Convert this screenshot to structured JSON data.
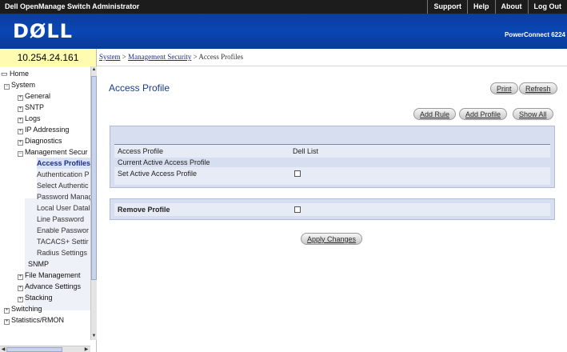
{
  "app": {
    "title": "Dell OpenManage Switch Administrator",
    "top_links": [
      "Support",
      "Help",
      "About",
      "Log Out"
    ],
    "logo": "DØLL",
    "product": "PowerConnect 6224"
  },
  "ip_address": "10.254.24.161",
  "breadcrumb": {
    "items": [
      "System",
      "Management Security"
    ],
    "separator": " > ",
    "current": "Access Profiles"
  },
  "tree": [
    {
      "label": "Home",
      "icon": "home-icon"
    },
    {
      "label": "System",
      "icon": "minus"
    },
    {
      "label": "General",
      "icon": "plus"
    },
    {
      "label": "SNTP",
      "icon": "plus"
    },
    {
      "label": "Logs",
      "icon": "plus"
    },
    {
      "label": "IP Addressing",
      "icon": "plus"
    },
    {
      "label": "Diagnostics",
      "icon": "plus"
    },
    {
      "label": "Management Secur",
      "icon": "minus"
    },
    {
      "label": "Access Profiles",
      "icon": "none"
    },
    {
      "label": "Authentication P",
      "icon": "none"
    },
    {
      "label": "Select Authentic",
      "icon": "none"
    },
    {
      "label": "Password Manaç",
      "icon": "none"
    },
    {
      "label": "Local User Datal",
      "icon": "none"
    },
    {
      "label": "Line Password",
      "icon": "none"
    },
    {
      "label": "Enable Passwor",
      "icon": "none"
    },
    {
      "label": "TACACS+ Settir",
      "icon": "none"
    },
    {
      "label": "Radius Settings",
      "icon": "none"
    },
    {
      "label": "SNMP",
      "icon": "none"
    },
    {
      "label": "File Management",
      "icon": "plus"
    },
    {
      "label": "Advance Settings",
      "icon": "plus"
    },
    {
      "label": "Stacking",
      "icon": "plus"
    },
    {
      "label": "Switching",
      "icon": "plus"
    },
    {
      "label": "Statistics/RMON",
      "icon": "plus"
    }
  ],
  "page": {
    "title": "Access Profile",
    "buttons": {
      "print": "Print",
      "refresh": "Refresh",
      "add_rule": "Add Rule",
      "add_profile": "Add Profile",
      "show_all": "Show All",
      "apply": "Apply Changes"
    },
    "form": {
      "access_profile_label": "Access Profile",
      "access_profile_value": "Dell List",
      "current_active_label": "Current Active Access Profile",
      "set_active_label": "Set Active Access Profile",
      "set_active_checked": false,
      "remove_label": "Remove Profile",
      "remove_checked": false
    }
  },
  "colors": {
    "topbar": "#1c1c1c",
    "banner": "#0a46b4",
    "ip_box": "#fffbb0",
    "title": "#1b3c8c",
    "panel": "#d7deef"
  }
}
